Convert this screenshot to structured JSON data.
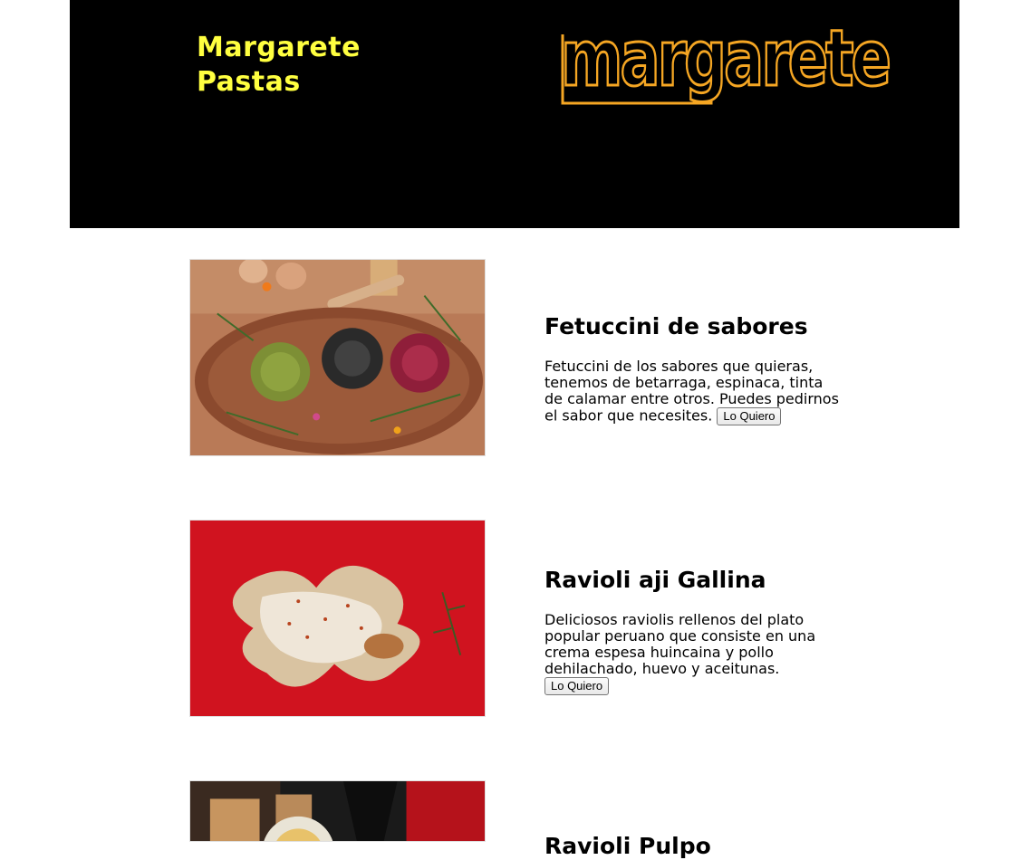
{
  "header": {
    "title_line1": "Margarete",
    "title_line2": "Pastas",
    "logo_text": "margarete",
    "colors": {
      "background": "#000000",
      "title": "#ffff40",
      "logo": "#f5a623"
    }
  },
  "products": [
    {
      "name": "Fetuccini de sabores",
      "description": "Fetuccini de los sabores que quieras, tenemos de betarraga, espinaca, tinta de calamar entre otros. Puedes pedirnos el sabor que necesites.",
      "button_label": "Lo Quiero",
      "image": "pasta-nests-on-wooden-plate"
    },
    {
      "name": "Ravioli aji Gallina",
      "description": "Deliciosos raviolis rellenos del plato popular peruano que consiste en una crema espesa huincaina y pollo dehilachado, huevo y aceitunas.",
      "button_label": "Lo Quiero",
      "image": "ravioli-on-red-plate"
    },
    {
      "name": "Ravioli Pulpo",
      "image": "dish-with-wine-bottle"
    }
  ]
}
